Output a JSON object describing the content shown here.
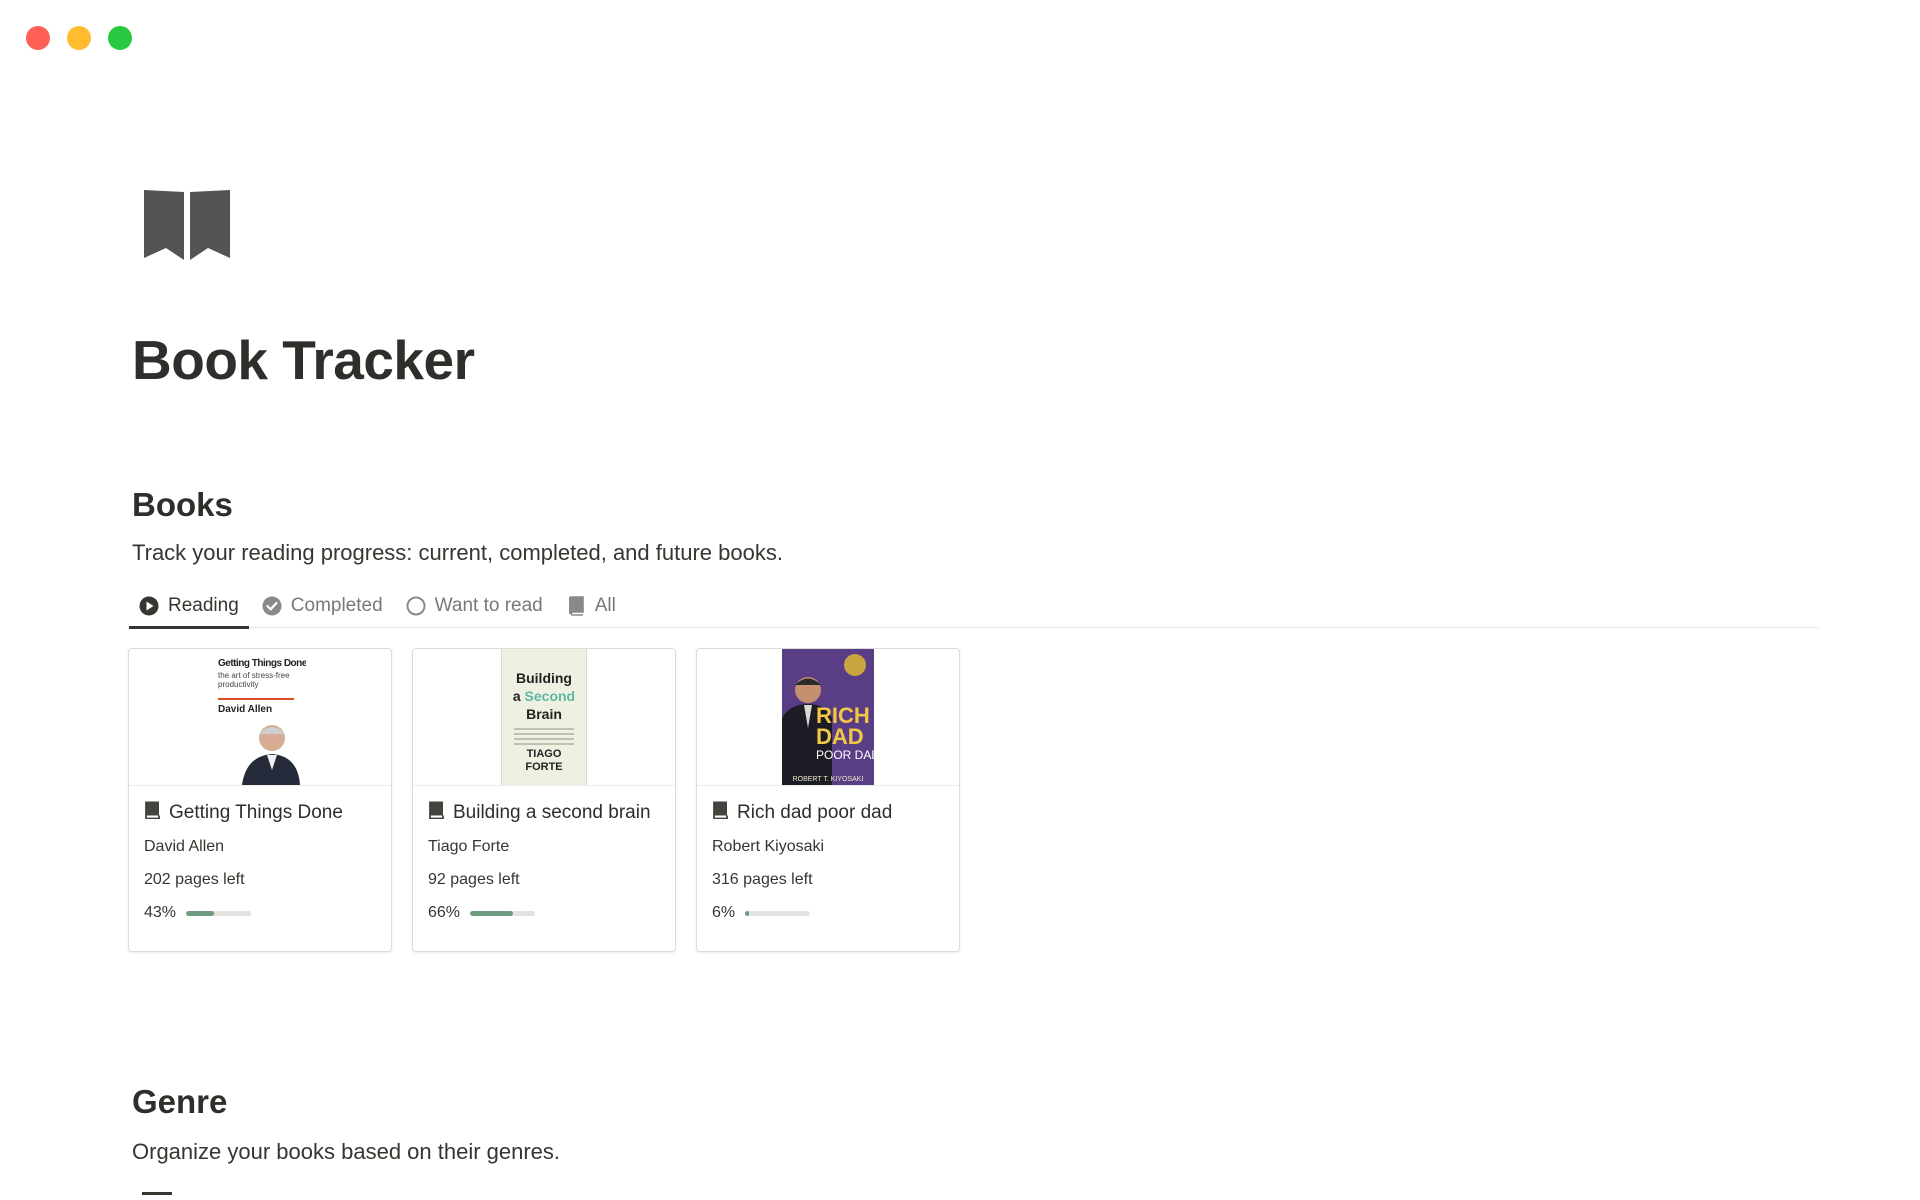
{
  "page": {
    "title": "Book Tracker",
    "icon": "open-book-icon"
  },
  "books_section": {
    "heading": "Books",
    "description": "Track your reading progress: current, completed, and future books.",
    "tabs": [
      {
        "label": "Reading",
        "icon": "play-circle-icon",
        "active": true
      },
      {
        "label": "Completed",
        "icon": "check-circle-icon",
        "active": false
      },
      {
        "label": "Want to read",
        "icon": "empty-circle-icon",
        "active": false
      },
      {
        "label": "All",
        "icon": "book-icon",
        "active": false
      }
    ],
    "cards": [
      {
        "title": "Getting Things Done",
        "author": "David Allen",
        "pages_left": "202 pages left",
        "progress_label": "43%",
        "progress": 0.43,
        "cover": {
          "line1": "Getting Things Done",
          "line2": "the art of stress-free productivity",
          "line3": "David Allen"
        }
      },
      {
        "title": "Building a second brain",
        "author": "Tiago Forte",
        "pages_left": "92 pages left",
        "progress_label": "66%",
        "progress": 0.66,
        "cover": {
          "line1": "Building",
          "line2a": "a",
          "line2b": "Second",
          "line3": "Brain",
          "line4": "TIAGO",
          "line5": "FORTE"
        }
      },
      {
        "title": "Rich dad poor dad",
        "author": "Robert Kiyosaki",
        "pages_left": "316 pages left",
        "progress_label": "6%",
        "progress": 0.06,
        "cover": {
          "line1": "RICH",
          "line2": "DAD",
          "line3": "POOR DAD",
          "line4": "ROBERT T. KIYOSAKI"
        }
      }
    ]
  },
  "genre_section": {
    "heading": "Genre",
    "description": "Organize your books based on their genres."
  },
  "colors": {
    "progress_fill": "#6c9b7d",
    "progress_track": "#e3e2e0",
    "text": "#37352f",
    "muted_text": "#7a7874"
  }
}
